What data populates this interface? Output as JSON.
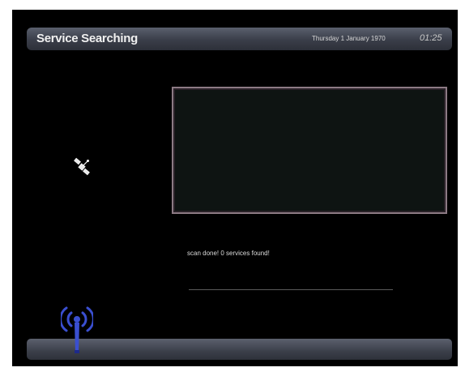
{
  "header": {
    "title": "Service Searching",
    "date": "Thursday 1 January 1970",
    "time": "01:25"
  },
  "scan": {
    "status": "scan done! 0 services found!",
    "progress": 1.0
  },
  "icons": {
    "scan": "satellite-icon",
    "signal": "antenna-signal-icon"
  },
  "colors": {
    "accent": "#3a4fd0",
    "frame_border": "#8c7a84"
  }
}
